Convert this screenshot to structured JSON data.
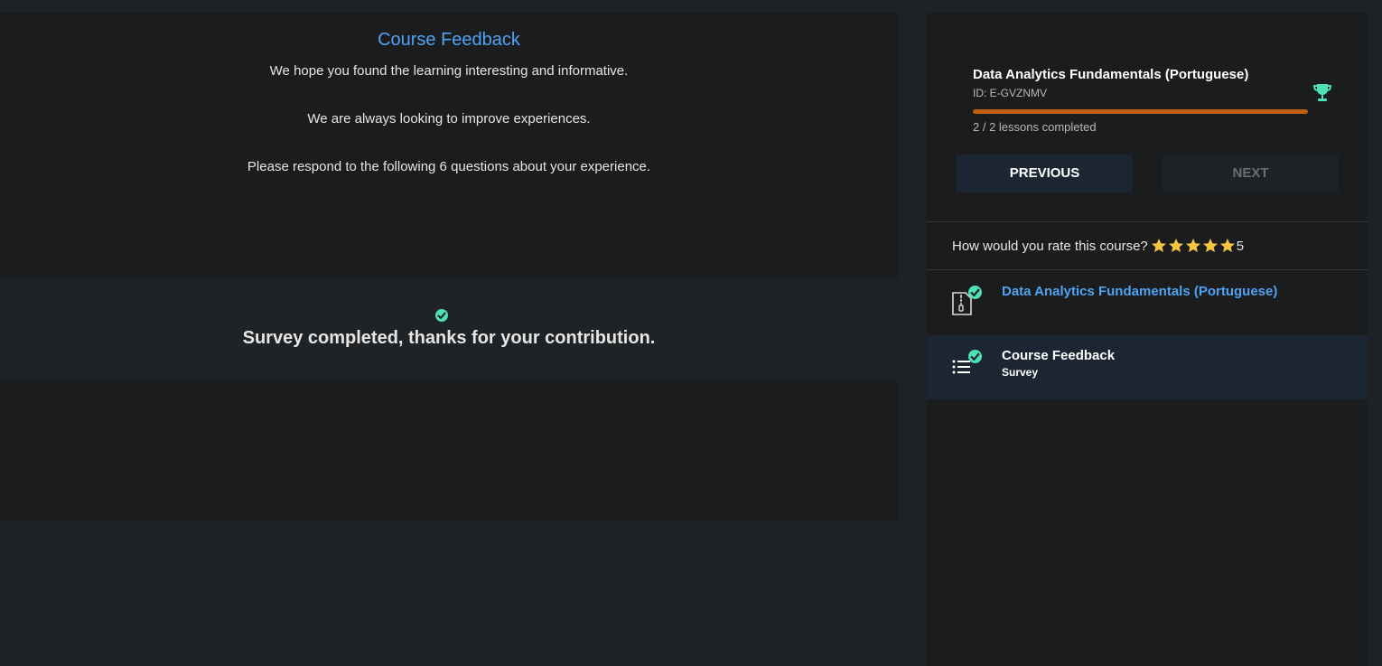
{
  "main": {
    "intro": {
      "title": "Course Feedback",
      "line1": "We hope you found the learning interesting and informative.",
      "line2": "We are always looking to improve experiences.",
      "line3": "Please respond to the following 6 questions about your experience."
    },
    "survey_status": {
      "message": "Survey completed, thanks for your contribution.",
      "icon": "check-circle-icon"
    }
  },
  "sidebar": {
    "course": {
      "title": "Data Analytics Fundamentals (Portuguese)",
      "id": "ID: E-GVZNMV",
      "progress_text": "2 / 2 lessons completed",
      "progress_fraction": 1.0,
      "trophy_icon": "trophy-icon"
    },
    "buttons": {
      "previous": "PREVIOUS",
      "next": "NEXT"
    },
    "rating": {
      "question": "How would you rate this course?",
      "stars": 5,
      "value": "5"
    },
    "lessons": [
      {
        "title": "Data Analytics Fundamentals (Portuguese)",
        "subtitle": "",
        "icon": "zip-file-icon",
        "completed": true
      },
      {
        "title": "Course Feedback",
        "subtitle": "Survey",
        "icon": "list-icon",
        "completed": true
      }
    ]
  },
  "colors": {
    "accent": "#4ea3f2",
    "success": "#4ee0b3",
    "progress": "#c2600f",
    "star": "#f5c542"
  }
}
